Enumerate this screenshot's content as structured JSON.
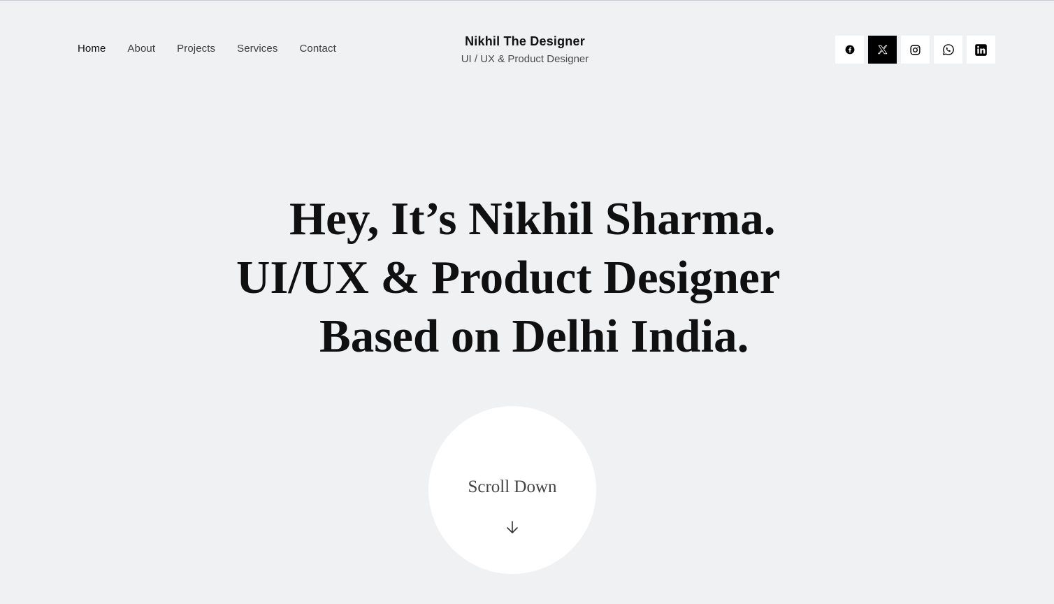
{
  "nav": {
    "items": [
      {
        "label": "Home",
        "active": true
      },
      {
        "label": "About"
      },
      {
        "label": "Projects"
      },
      {
        "label": "Services"
      },
      {
        "label": "Contact"
      }
    ]
  },
  "brand": {
    "title": "Nikhil The Designer",
    "subtitle": "UI / UX & Product Designer"
  },
  "social": [
    {
      "icon": "facebook-icon",
      "highlight": false
    },
    {
      "icon": "x-twitter-icon",
      "highlight": true
    },
    {
      "icon": "instagram-icon",
      "highlight": false
    },
    {
      "icon": "whatsapp-icon",
      "highlight": false
    },
    {
      "icon": "linkedin-icon",
      "highlight": false
    }
  ],
  "hero": {
    "line1": "Hey, It’s Nikhil Sharma.",
    "line2": "UI/UX & Product Designer",
    "line3": "Based on Delhi India."
  },
  "scroll": {
    "label": "Scroll Down",
    "icon": "arrow-down-icon"
  },
  "colors": {
    "background": "#f0f1f3",
    "text": "#111111",
    "card": "#ffffff",
    "highlight": "#000000"
  }
}
